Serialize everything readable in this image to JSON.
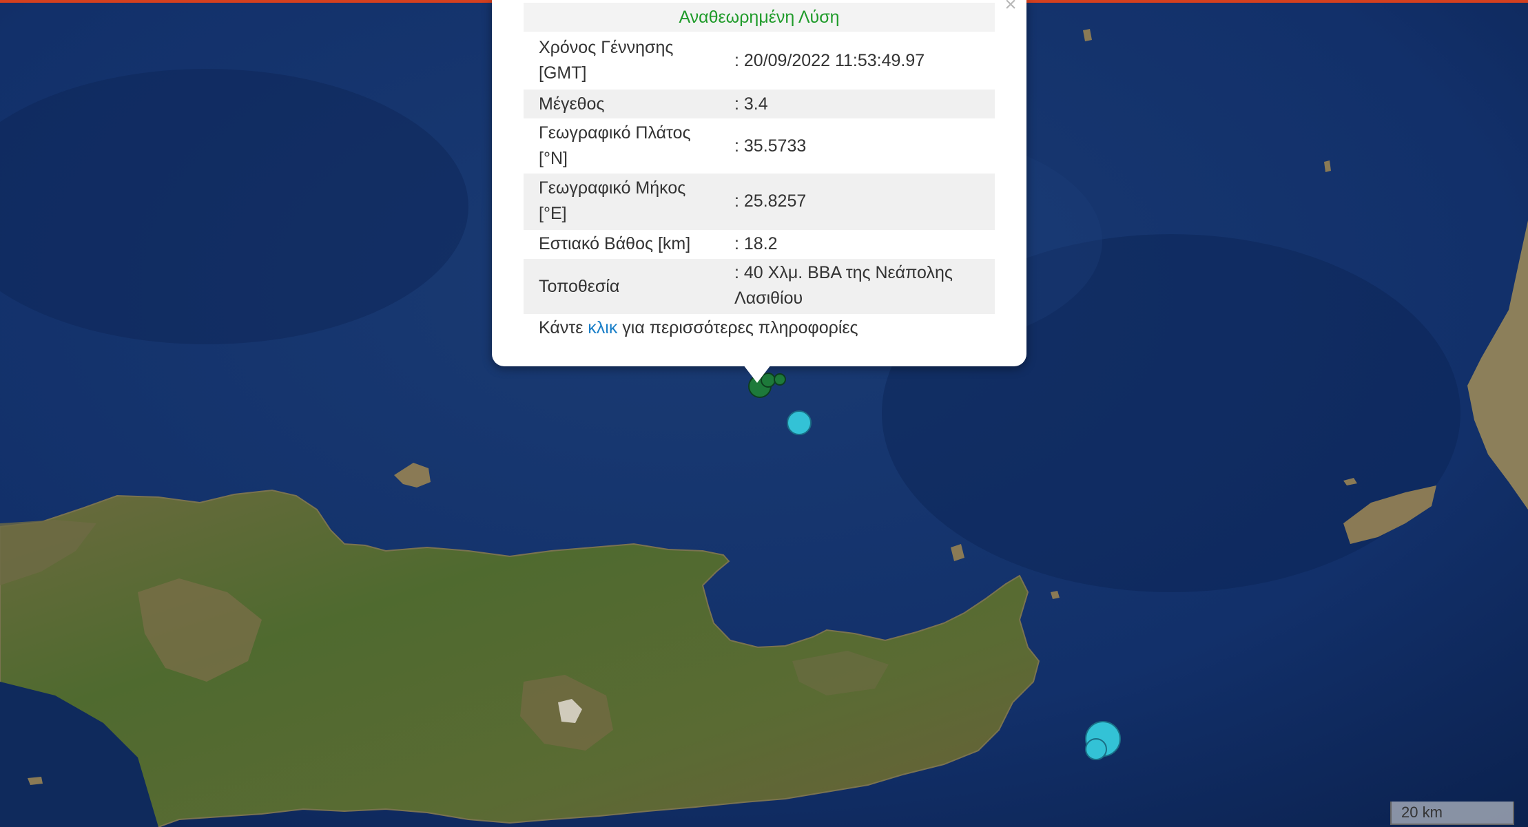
{
  "colors": {
    "sea": "#0f2a5c",
    "land": "#4f6a2f",
    "top_bar": "#d4401f",
    "popup_title": "#1f9b2a",
    "link": "#1a7fc8",
    "marker_green": "#1d7a3a",
    "marker_cyan": "#33c2d6"
  },
  "popup": {
    "close_icon": "close-icon",
    "close_glyph": "×",
    "title": "Αναθεωρημένη Λύση",
    "rows": [
      {
        "label": [
          "Χρόνος Γέννησης",
          "[GMT]"
        ],
        "value": [
          ": 20/09/2022 11:53:49.97"
        ]
      },
      {
        "label": [
          "Μέγεθος"
        ],
        "value": [
          ": 3.4"
        ]
      },
      {
        "label": [
          "Γεωγραφικό Πλάτος",
          "[°N]"
        ],
        "value": [
          ": 35.5733"
        ]
      },
      {
        "label": [
          "Γεωγραφικό Μήκος",
          "[°E]"
        ],
        "value": [
          ": 25.8257"
        ]
      },
      {
        "label": [
          "Εστιακό Βάθος [km]"
        ],
        "value": [
          ": 18.2"
        ]
      },
      {
        "label": [
          "Τοποθεσία"
        ],
        "value": [
          ": 40 Χλμ. ΒΒΑ της Νεάπολης",
          "Λασιθίου"
        ]
      }
    ],
    "footer": {
      "before": "Κάντε ",
      "link": "κλικ",
      "after": " για περισσότερες πληροφορίες"
    }
  },
  "markers": [
    {
      "kind": "green"
    },
    {
      "kind": "green"
    },
    {
      "kind": "green"
    },
    {
      "kind": "cyan"
    },
    {
      "kind": "cyan"
    },
    {
      "kind": "cyan"
    }
  ],
  "scale": {
    "label": "20 km"
  }
}
